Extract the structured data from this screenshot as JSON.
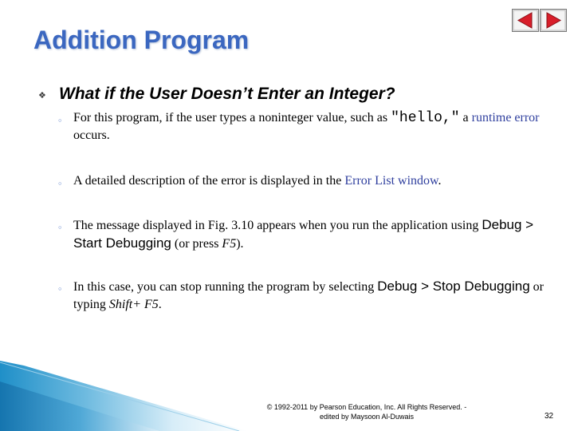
{
  "slide": {
    "title": "Addition Program",
    "heading": "What if the User Doesn’t Enter an Integer?",
    "items": [
      {
        "t1": "For this program, if the user types a noninteger value, such as ",
        "code": "\"hello,\"",
        "t2": " a ",
        "hl": "runtime error",
        "t3": " occurs."
      },
      {
        "t1": "A detailed description of the error is displayed in the ",
        "hl": "Error List window",
        "t2": "."
      },
      {
        "t1": "The message displayed in Fig. 3.10 appears when you run the application using ",
        "menu": "Debug > Start Debugging",
        "t2": " (or press ",
        "key": "F5",
        "t3": ")."
      },
      {
        "t1": "In this case, you can stop running the program by selecting ",
        "menu": "Debug > Stop Debugging",
        "t2": " or typing ",
        "key": "Shift+ F5",
        "t3": "."
      }
    ],
    "footer": {
      "line1": "© 1992-2011 by Pearson Education, Inc. All Rights Reserved. -",
      "line2": "edited by Maysoon Al-Duwais"
    },
    "page_number": "32"
  },
  "nav": {
    "prev_icon": "triangle-left-icon",
    "next_icon": "triangle-right-icon",
    "color": "#d81e2a"
  },
  "colors": {
    "title": "#3b67c0",
    "highlight": "#2f3f9e",
    "sub_bullet": "#3b67c0",
    "decoration": "#1f8fc8"
  }
}
